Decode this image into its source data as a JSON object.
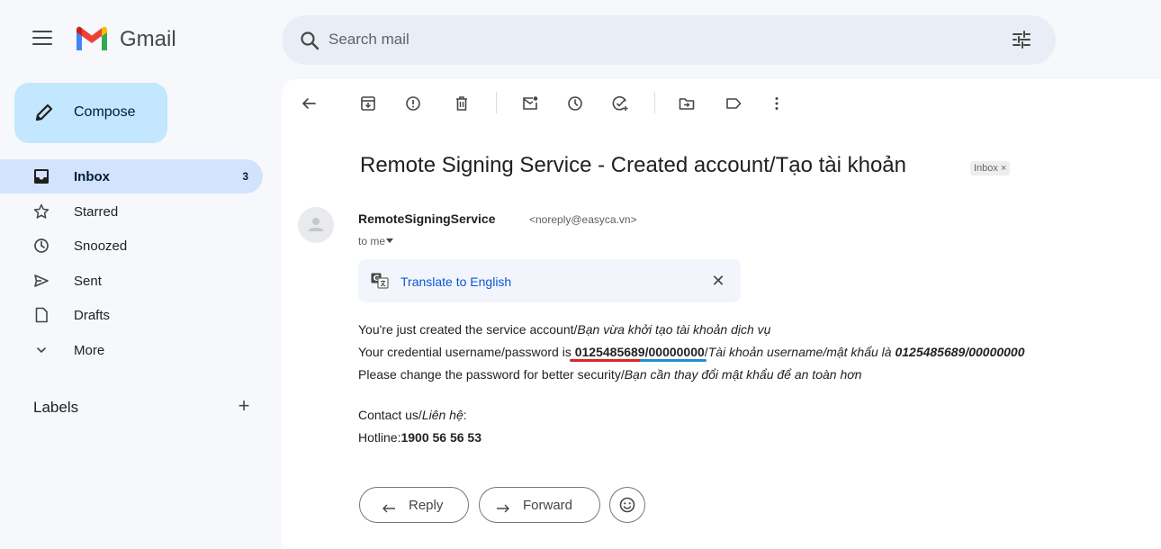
{
  "app": {
    "name": "Gmail"
  },
  "search": {
    "placeholder": "Search mail"
  },
  "sidebar": {
    "compose_label": "Compose",
    "items": [
      {
        "label": "Inbox",
        "count": "3",
        "icon": "inbox-icon"
      },
      {
        "label": "Starred",
        "count": "",
        "icon": "star-icon"
      },
      {
        "label": "Snoozed",
        "count": "",
        "icon": "clock-icon"
      },
      {
        "label": "Sent",
        "count": "",
        "icon": "send-icon"
      },
      {
        "label": "Drafts",
        "count": "",
        "icon": "draft-icon"
      },
      {
        "label": "More",
        "count": "",
        "icon": "chevron-down-icon"
      }
    ],
    "labels_heading": "Labels",
    "labels_add": "+"
  },
  "email": {
    "subject": "Remote Signing Service - Created account/Tạo tài khoản",
    "chip": "Inbox ×",
    "sender_name": "RemoteSigningService",
    "sender_email": "<noreply@easyca.vn>",
    "to": "to me",
    "translate_label": "Translate to English",
    "translate_close": "✕",
    "body": {
      "line1_a": "You're just created the service account/",
      "line1_b": "Bạn vừa khởi tạo tài khoản dịch vụ",
      "line2_a": "Your credential username/password is ",
      "line2_user": "0125485689",
      "line2_sep": "/",
      "line2_pass": "00000000",
      "line2_sep2": "/",
      "line2_b": "Tài khoản username/mật khẩu là ",
      "line2_c": "0125485689/00000000",
      "line3_a": "Please change the password for better security/",
      "line3_b": "Bạn cần thay đổi mật khẩu để an toàn hơn",
      "line4_a": "Contact us/",
      "line4_b": "Liên hệ",
      "line4_c": ":",
      "line5_a": "Hotline:",
      "line5_b": "1900 56 56 53"
    },
    "reply_label": "Reply",
    "forward_label": "Forward"
  },
  "colors": {
    "compose_bg": "#c2e7ff",
    "active_nav_bg": "#d3e3fd",
    "link_blue": "#0b57d0",
    "underline_red": "#d62828",
    "underline_blue": "#1f8fd6"
  }
}
